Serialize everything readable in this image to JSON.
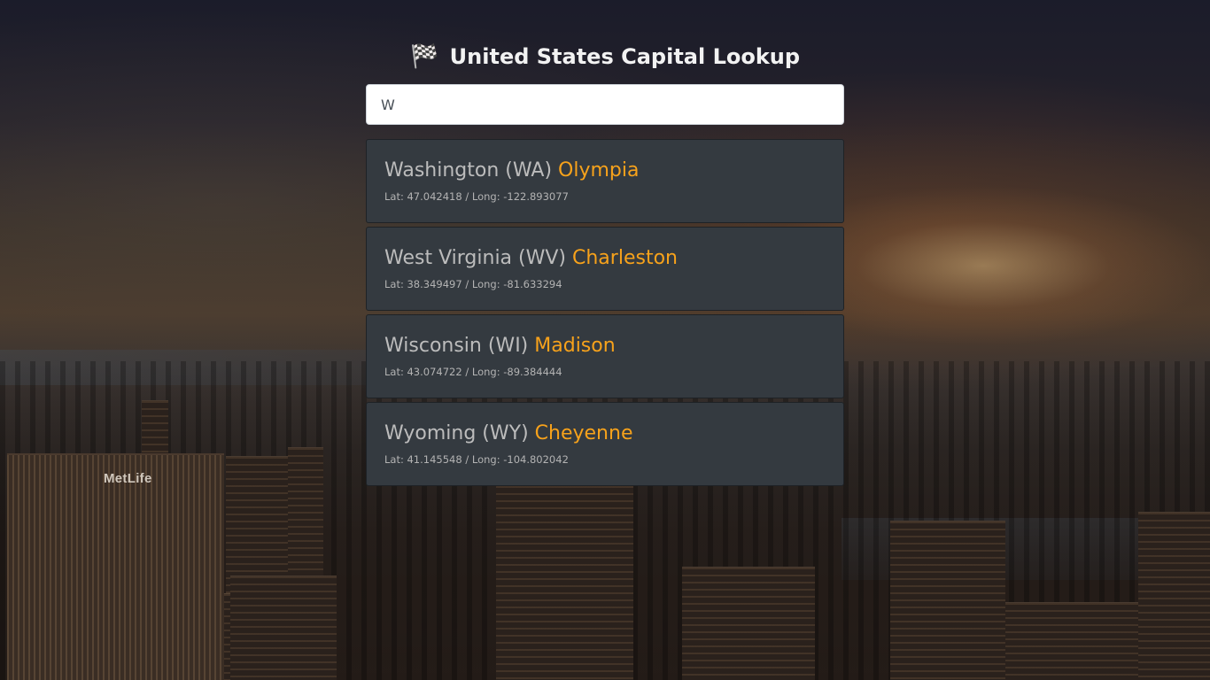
{
  "header": {
    "flag_glyph": "🏁",
    "title": "United States Capital Lookup"
  },
  "search": {
    "value": "W",
    "placeholder": ""
  },
  "background": {
    "sign": "MetLife"
  },
  "colors": {
    "capital_accent": "#f7a21b",
    "card_bg": "#343a40",
    "state_text": "#bcbcbc"
  },
  "results": [
    {
      "state": "Washington (WA)",
      "capital": "Olympia",
      "coords": "Lat: 47.042418 / Long: -122.893077"
    },
    {
      "state": "West Virginia (WV)",
      "capital": "Charleston",
      "coords": "Lat: 38.349497 / Long: -81.633294"
    },
    {
      "state": "Wisconsin (WI)",
      "capital": "Madison",
      "coords": "Lat: 43.074722 / Long: -89.384444"
    },
    {
      "state": "Wyoming (WY)",
      "capital": "Cheyenne",
      "coords": "Lat: 41.145548 / Long: -104.802042"
    }
  ]
}
